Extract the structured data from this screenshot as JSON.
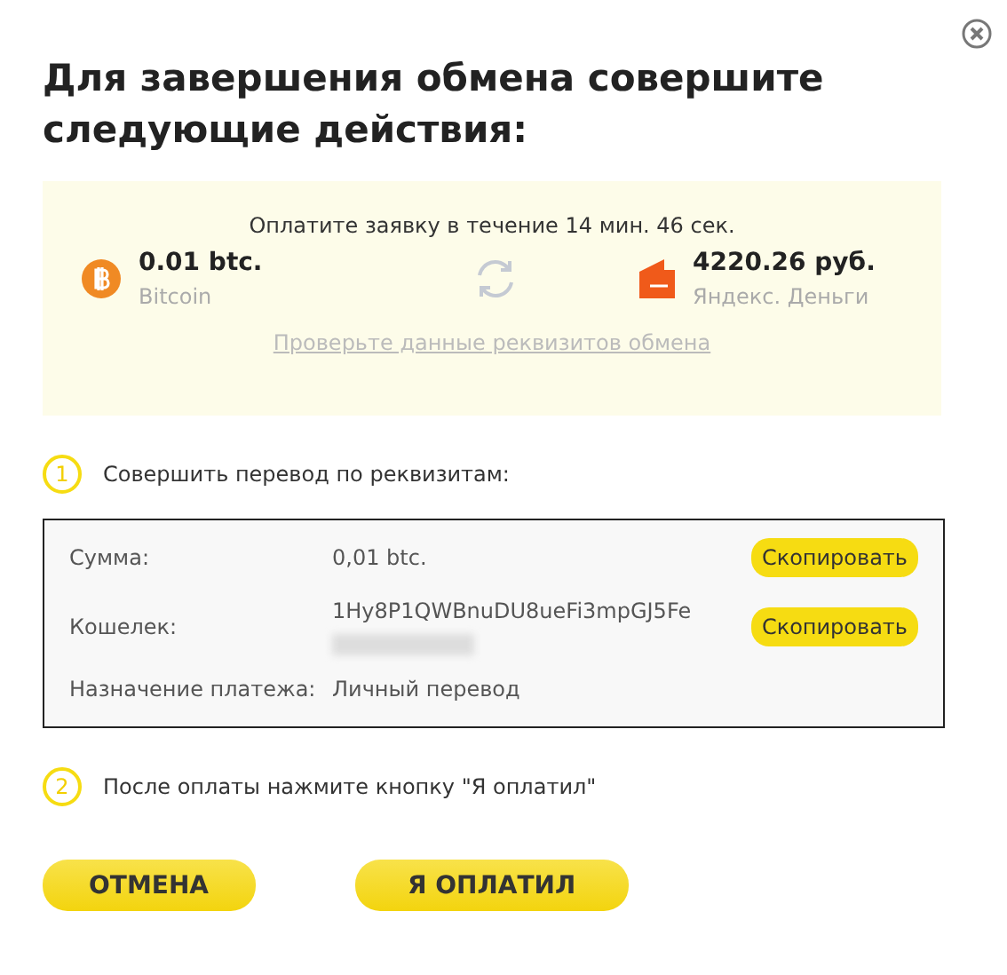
{
  "title": "Для завершения обмена совершите следующие действия:",
  "summary": {
    "timer": "Оплатите заявку в течение 14 мин. 46 сек.",
    "from": {
      "amount": "0.01 btc.",
      "currency": "Bitcoin",
      "kind": "bitcoin"
    },
    "to": {
      "amount": "4220.26 руб.",
      "currency": "Яндекс. Деньги",
      "kind": "wallet"
    },
    "link": "Проверьте данные реквизитов обмена"
  },
  "steps": [
    {
      "number": "1",
      "text": "Совершить перевод по реквизитам:"
    },
    {
      "number": "2",
      "text": "После оплаты нажмите кнопку \"Я оплатил\""
    }
  ],
  "details": [
    {
      "label": "Сумма:",
      "value": "0,01 btc.",
      "redacted": false,
      "button": "Скопировать"
    },
    {
      "label": "Кошелек:",
      "value": "1Hy8P1QWBnuDU8ueFi3mpGJ5Fe",
      "redacted": true,
      "button": "Скопировать"
    },
    {
      "label": "Назначение платежа:",
      "value": "Личный перевод",
      "redacted": false
    }
  ],
  "buttons": [
    {
      "label": "ОТМЕНА"
    },
    {
      "label": "Я ОПЛАТИЛ"
    }
  ]
}
